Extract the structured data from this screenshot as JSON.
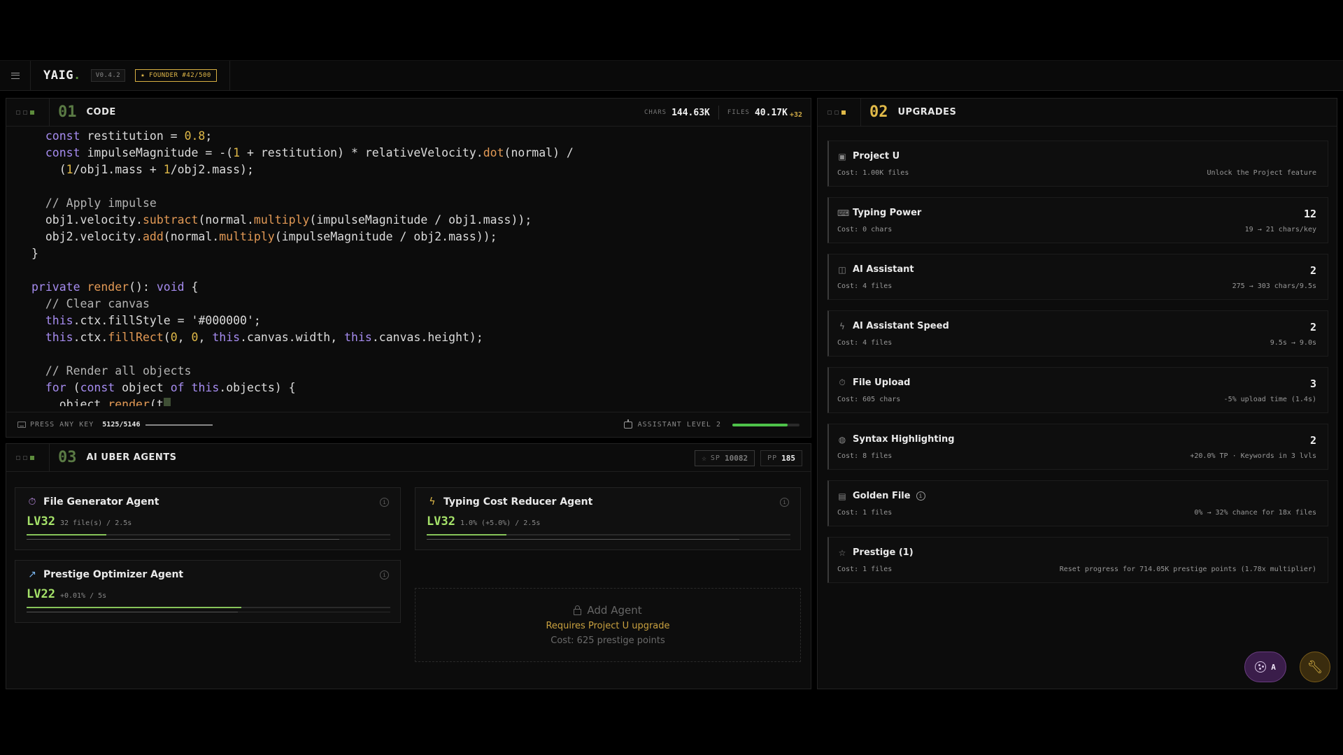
{
  "header": {
    "logo": "YAIG",
    "logo_dot": ".",
    "version": "V0.4.2",
    "founder": "★ FOUNDER #42/500"
  },
  "code_panel": {
    "number": "01",
    "title": "CODE",
    "chars_label": "CHARS",
    "chars_value": "144.63K",
    "files_label": "FILES",
    "files_value": "40.17K",
    "files_delta": "+32",
    "press_label": "PRESS ANY KEY",
    "press_count": "5125/5146",
    "press_progress": 0.996,
    "assistant_label": "ASSISTANT LEVEL 2",
    "assistant_progress": 0.82
  },
  "code_lines": [
    [
      {
        "t": "  "
      },
      {
        "t": "const",
        "c": "kw"
      },
      {
        "t": " restitution = "
      },
      {
        "t": "0.8",
        "c": "num"
      },
      {
        "t": ";"
      }
    ],
    [
      {
        "t": "  "
      },
      {
        "t": "const",
        "c": "kw"
      },
      {
        "t": " impulseMagnitude = -("
      },
      {
        "t": "1",
        "c": "num"
      },
      {
        "t": " + restitution) * relativeVelocity."
      },
      {
        "t": "dot",
        "c": "fn"
      },
      {
        "t": "(normal) /"
      }
    ],
    [
      {
        "t": "    ("
      },
      {
        "t": "1",
        "c": "num"
      },
      {
        "t": "/obj1.mass + "
      },
      {
        "t": "1",
        "c": "num"
      },
      {
        "t": "/obj2.mass);"
      }
    ],
    [
      {
        "t": ""
      }
    ],
    [
      {
        "t": "  "
      },
      {
        "t": "// Apply impulse",
        "c": "cmt"
      }
    ],
    [
      {
        "t": "  obj1.velocity."
      },
      {
        "t": "subtract",
        "c": "fn"
      },
      {
        "t": "(normal."
      },
      {
        "t": "multiply",
        "c": "fn"
      },
      {
        "t": "(impulseMagnitude / obj1.mass));"
      }
    ],
    [
      {
        "t": "  obj2.velocity."
      },
      {
        "t": "add",
        "c": "fn"
      },
      {
        "t": "(normal."
      },
      {
        "t": "multiply",
        "c": "fn"
      },
      {
        "t": "(impulseMagnitude / obj2.mass));"
      }
    ],
    [
      {
        "t": "}"
      }
    ],
    [
      {
        "t": ""
      }
    ],
    [
      {
        "t": "private",
        "c": "kw"
      },
      {
        "t": " "
      },
      {
        "t": "render",
        "c": "fn"
      },
      {
        "t": "(): "
      },
      {
        "t": "void",
        "c": "kw"
      },
      {
        "t": " {"
      }
    ],
    [
      {
        "t": "  "
      },
      {
        "t": "// Clear canvas",
        "c": "cmt"
      }
    ],
    [
      {
        "t": "  "
      },
      {
        "t": "this",
        "c": "kw"
      },
      {
        "t": ".ctx.fillStyle = "
      },
      {
        "t": "'#000000'",
        "c": "str"
      },
      {
        "t": ";"
      }
    ],
    [
      {
        "t": "  "
      },
      {
        "t": "this",
        "c": "kw"
      },
      {
        "t": ".ctx."
      },
      {
        "t": "fillRect",
        "c": "fn"
      },
      {
        "t": "("
      },
      {
        "t": "0",
        "c": "num"
      },
      {
        "t": ", "
      },
      {
        "t": "0",
        "c": "num"
      },
      {
        "t": ", "
      },
      {
        "t": "this",
        "c": "kw"
      },
      {
        "t": ".canvas.width, "
      },
      {
        "t": "this",
        "c": "kw"
      },
      {
        "t": ".canvas.height);"
      }
    ],
    [
      {
        "t": ""
      }
    ],
    [
      {
        "t": "  "
      },
      {
        "t": "// Render all objects",
        "c": "cmt"
      }
    ],
    [
      {
        "t": "  "
      },
      {
        "t": "for",
        "c": "kw"
      },
      {
        "t": " ("
      },
      {
        "t": "const",
        "c": "kw"
      },
      {
        "t": " object "
      },
      {
        "t": "of",
        "c": "kw"
      },
      {
        "t": " "
      },
      {
        "t": "this",
        "c": "kw"
      },
      {
        "t": ".objects) {"
      }
    ],
    [
      {
        "t": "    object."
      },
      {
        "t": "render",
        "c": "fn"
      },
      {
        "t": "(t"
      }
    ]
  ],
  "agents_panel": {
    "number": "03",
    "title": "AI UBER AGENTS",
    "sp_label": "SP",
    "sp_value": "10082",
    "pp_label": "PP",
    "pp_value": "185",
    "agents": [
      {
        "name": "File Generator Agent",
        "icon": "timer-icon",
        "level": "LV32",
        "meta": "32 file(s) / 2.5s",
        "progress": 0.22,
        "progress2": 0.86
      },
      {
        "name": "Typing Cost Reducer Agent",
        "icon": "lightning-icon",
        "level": "LV32",
        "meta": "1.0% (+5.0%) / 2.5s",
        "progress": 0.22,
        "progress2": 0.86
      },
      {
        "name": "Prestige Optimizer Agent",
        "icon": "trending-up-icon",
        "level": "LV22",
        "meta": "+0.01% / 5s",
        "progress": 0.59,
        "progress2": 0.58
      }
    ],
    "add_agent": {
      "title": "Add Agent",
      "requirement": "Requires Project U upgrade",
      "cost": "Cost: 625 prestige points"
    }
  },
  "upgrades_panel": {
    "number": "02",
    "title": "UPGRADES",
    "items": [
      {
        "name": "Project U",
        "icon": "chip-icon",
        "cost": "Cost: 1.00K files",
        "level": "",
        "desc": "Unlock the Project feature"
      },
      {
        "name": "Typing Power",
        "icon": "keyboard-icon",
        "cost": "Cost: 0 chars",
        "level": "12",
        "desc": "19 → 21 chars/key"
      },
      {
        "name": "AI Assistant",
        "icon": "robot-icon",
        "cost": "Cost: 4 files",
        "level": "2",
        "desc": "275 → 303 chars/9.5s"
      },
      {
        "name": "AI Assistant Speed",
        "icon": "lightning-icon",
        "cost": "Cost: 4 files",
        "level": "2",
        "desc": "9.5s → 9.0s"
      },
      {
        "name": "File Upload",
        "icon": "timer-icon",
        "cost": "Cost: 605 chars",
        "level": "3",
        "desc": "-5% upload time (1.4s)"
      },
      {
        "name": "Syntax Highlighting",
        "icon": "palette-icon",
        "cost": "Cost: 8 files",
        "level": "2",
        "desc": "+20.0% TP · Keywords in 3 lvls"
      },
      {
        "name": "Golden File",
        "icon": "document-icon",
        "cost": "Cost: 1 files",
        "level": "",
        "desc": "0% → 32% chance for 18x files",
        "info": "i"
      },
      {
        "name": "Prestige (1)",
        "icon": "star-icon",
        "cost": "Cost: 1 files",
        "level": "",
        "desc": "Reset progress for 714.05K prestige points (1.78x multiplier)"
      }
    ]
  },
  "floating": {
    "theme_label": "A",
    "tools_icon": "wrench-icon"
  },
  "colors": {
    "accent_green": "#a6e36a",
    "accent_gold": "#e0b948",
    "keyword": "#a68cf0",
    "function": "#e29955"
  }
}
